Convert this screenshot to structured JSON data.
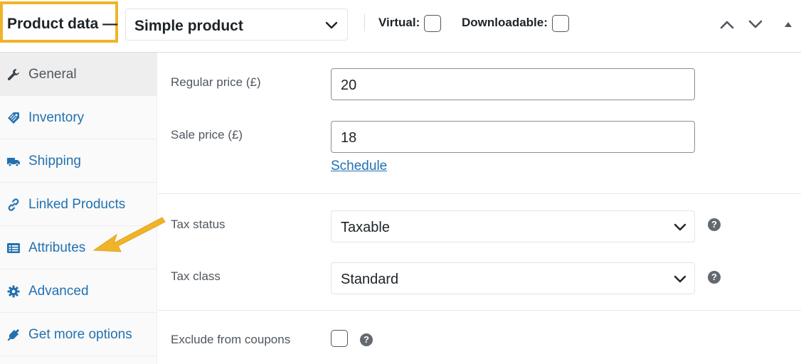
{
  "header": {
    "title": "Product data —",
    "product_type": "Simple product",
    "virtual_label": "Virtual:",
    "downloadable_label": "Downloadable:",
    "virtual_checked": false,
    "downloadable_checked": false
  },
  "tabs": [
    {
      "label": "General",
      "icon": "wrench-icon",
      "active": true
    },
    {
      "label": "Inventory",
      "icon": "tag-icon",
      "active": false
    },
    {
      "label": "Shipping",
      "icon": "truck-icon",
      "active": false
    },
    {
      "label": "Linked Products",
      "icon": "link-icon",
      "active": false
    },
    {
      "label": "Attributes",
      "icon": "list-view-icon",
      "active": false
    },
    {
      "label": "Advanced",
      "icon": "gear-icon",
      "active": false
    },
    {
      "label": "Get more options",
      "icon": "plugin-icon",
      "active": false
    }
  ],
  "general": {
    "regular_price_label": "Regular price (£)",
    "regular_price_value": "20",
    "sale_price_label": "Sale price (£)",
    "sale_price_value": "18",
    "schedule_link": "Schedule",
    "tax_status_label": "Tax status",
    "tax_status_value": "Taxable",
    "tax_class_label": "Tax class",
    "tax_class_value": "Standard",
    "exclude_coupons_label": "Exclude from coupons",
    "exclude_coupons_checked": false
  },
  "colors": {
    "highlight_border": "#f0b429",
    "arrow": "#f0b429",
    "link": "#2271b1",
    "active_tab_bg": "#eeeeee"
  }
}
